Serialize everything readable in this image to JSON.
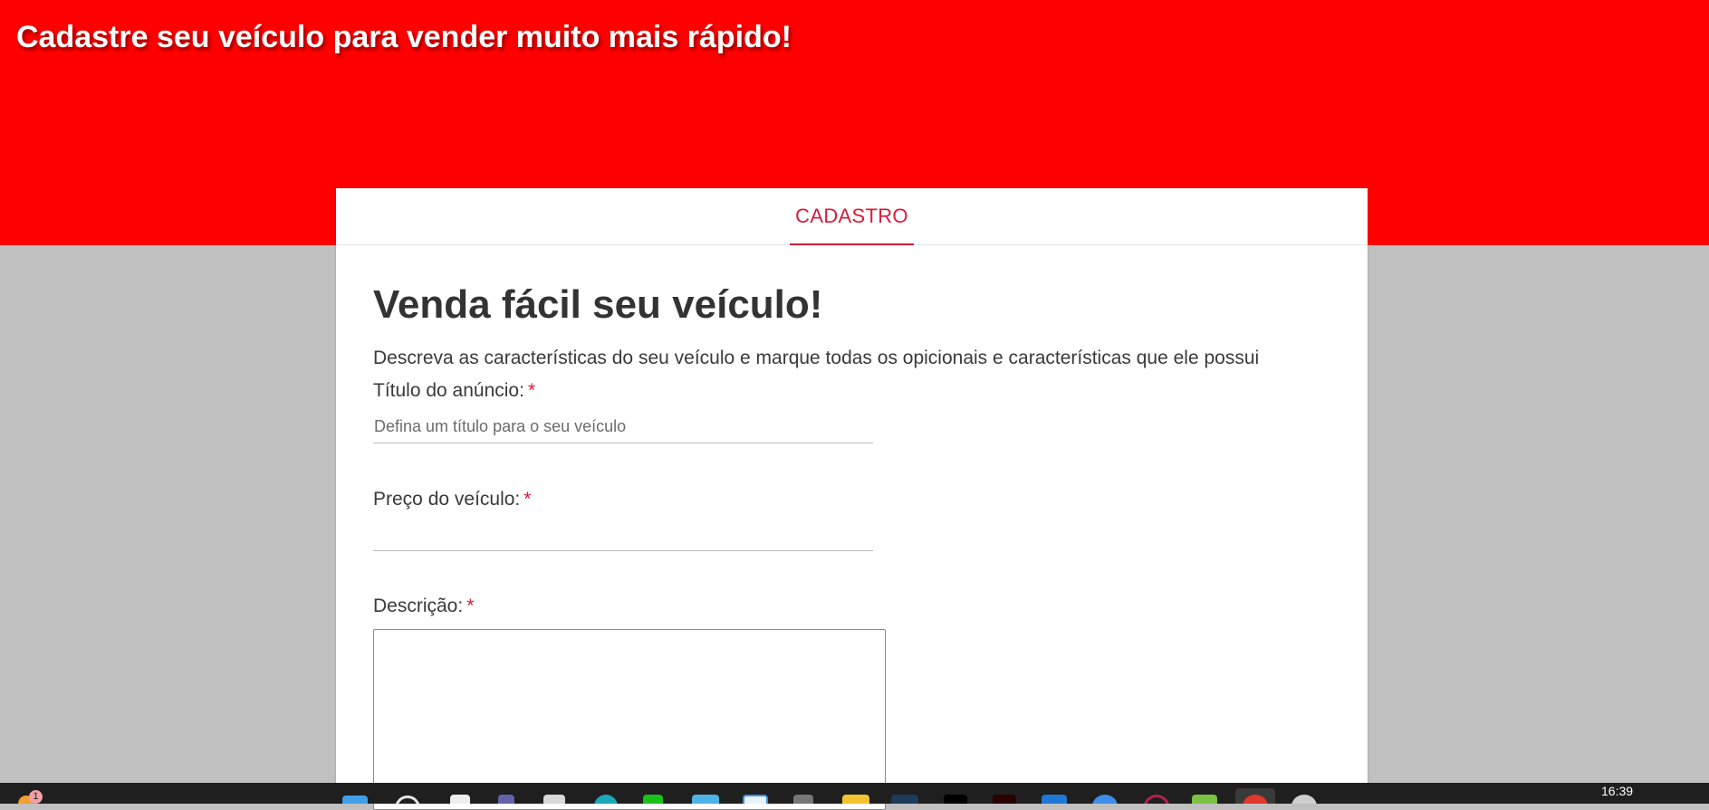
{
  "hero": {
    "headline": "Cadastre seu veículo para vender muito mais rápido!"
  },
  "tabs": [
    {
      "label": "CADASTRO",
      "active": true
    }
  ],
  "form": {
    "title": "Venda fácil seu veículo!",
    "subtitle": "Descreva as características do seu veículo e marque todas os opicionais e características que ele possui",
    "ad_title": {
      "label": "Título do anúncio:",
      "required_mark": "*",
      "placeholder": "Defina um título para o seu veículo",
      "value": ""
    },
    "price": {
      "label": "Preço do veículo:",
      "required_mark": "*",
      "placeholder": "",
      "value": ""
    },
    "description": {
      "label": "Descrição:",
      "required_mark": "*",
      "value": ""
    }
  },
  "taskbar": {
    "notification_badge": "1",
    "clock": "16:39",
    "icons": [
      "widgets-icon",
      "start-icon",
      "search-icon",
      "file-icon",
      "teams-icon",
      "notepad-icon",
      "browser-icon",
      "terminal-icon",
      "mail-icon",
      "calendar-icon",
      "gear-icon",
      "folder-icon",
      "vscode-icon",
      "app-icon",
      "app-icon",
      "store-icon",
      "chrome-icon",
      "app-icon",
      "android-icon",
      "chrome-red-icon",
      "disk-icon"
    ]
  },
  "colors": {
    "hero": "#ff0000",
    "accent": "#d81b3a",
    "background": "#c0c0c0"
  }
}
